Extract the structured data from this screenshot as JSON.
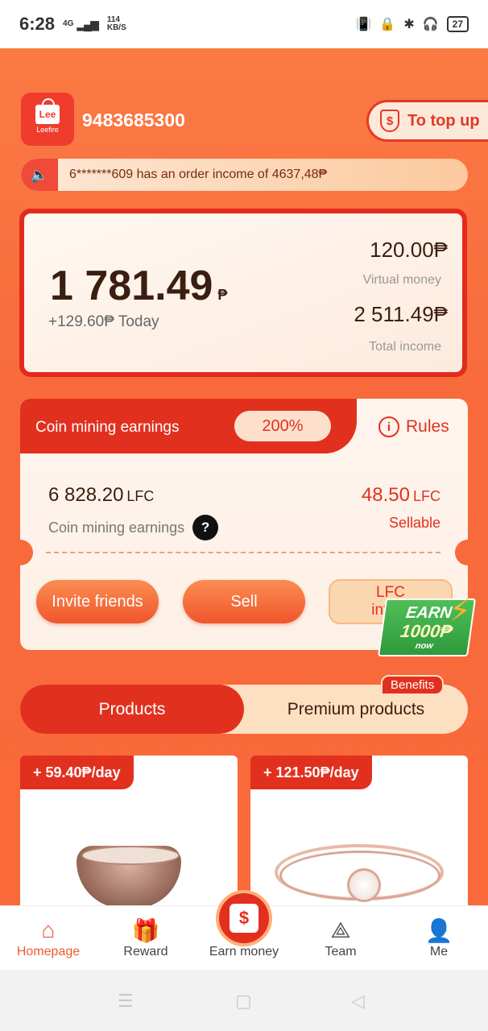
{
  "status_bar": {
    "time": "6:28",
    "network": "4G",
    "speed_value": "114",
    "speed_unit": "KB/S",
    "battery": "27"
  },
  "header": {
    "logo_text": "Lee",
    "logo_sub": "Leefire",
    "user_id": "9483685300",
    "topup_label": "To top up"
  },
  "notice": {
    "text": "6*******609 has an order income of 4637,48₱"
  },
  "balance": {
    "amount": "1 781.49",
    "currency": "₱",
    "today": "+129.60₱ Today",
    "virtual_value": "120.00₱",
    "virtual_label": "Virtual money",
    "total_value": "2 511.49₱",
    "total_label": "Total income"
  },
  "mining": {
    "title": "Coin mining earnings",
    "percent": "200%",
    "rules_label": "Rules",
    "amount": "6 828.20",
    "amount_unit": "LFC",
    "amount_label": "Coin mining earnings",
    "sellable_amount": "48.50",
    "sellable_unit": "LFC",
    "sellable_label": "Sellable",
    "invite_label": "Invite friends",
    "sell_label": "Sell",
    "intro_label_1": "LFC",
    "intro_label_2": "introd"
  },
  "promo": {
    "line1": "EARN",
    "line2": "1000₱",
    "line3": "now"
  },
  "tabs": {
    "products": "Products",
    "premium": "Premium products",
    "benefits": "Benefits"
  },
  "products": [
    {
      "badge": "+ 59.40₱/day"
    },
    {
      "badge": "+ 121.50₱/day"
    }
  ],
  "bottom_nav": {
    "home": "Homepage",
    "reward": "Reward",
    "earn": "Earn money",
    "team": "Team",
    "me": "Me"
  },
  "colors": {
    "accent": "#e2301f",
    "orange": "#f86a3c",
    "active_nav": "#f05a2c"
  }
}
